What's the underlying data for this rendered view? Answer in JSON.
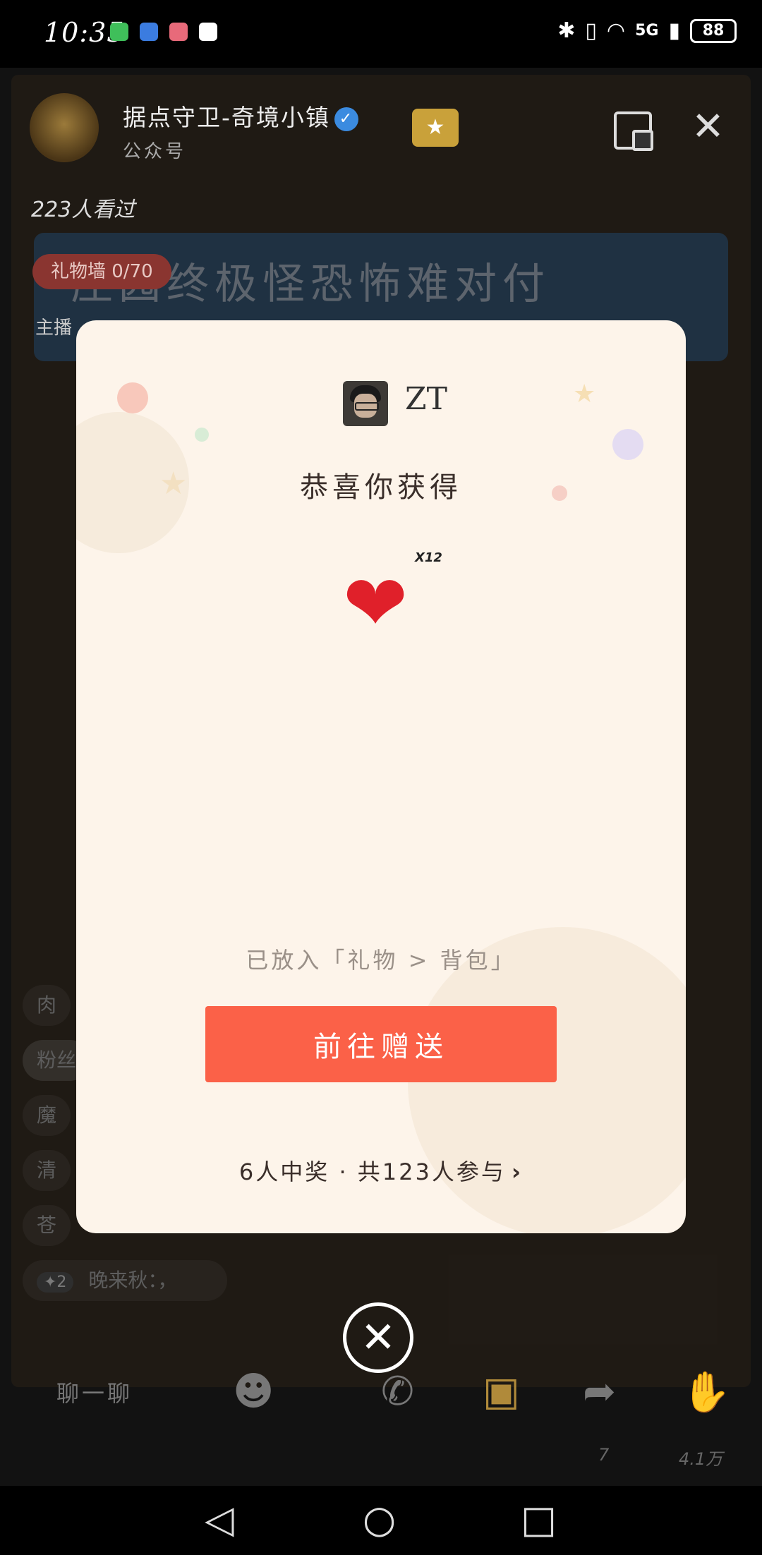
{
  "status_bar": {
    "time": "10:35",
    "network": "5G",
    "battery": "88"
  },
  "header": {
    "title": "据点守卫-奇境小镇",
    "subtitle": "公众号",
    "views": "223人看过"
  },
  "background": {
    "gift_wall": "礼物墙 0/70",
    "anchor_label": "主播",
    "banner_text": "庄园终极怪恐怖难对付",
    "chat_rows": [
      "肉",
      "粉丝",
      "魔",
      "清",
      "苍"
    ],
    "chat_sender": "晚来秋：，",
    "chat_badge": "✦2"
  },
  "modal": {
    "username": "ZT",
    "congrats": "恭喜你获得",
    "gift_icon": "heart",
    "quantity": "X12",
    "placed_text": "已放入「礼物 > 背包」",
    "send_button": "前往赠送",
    "winners": "6人中奖 · 共123人参与"
  },
  "bottom_bar": {
    "chat_label": "聊一聊",
    "share_count": "7",
    "like_count": "4.1万"
  },
  "colors": {
    "modal_bg": "#fdf4ea",
    "button": "#fb6148",
    "heart": "#e0202a"
  }
}
